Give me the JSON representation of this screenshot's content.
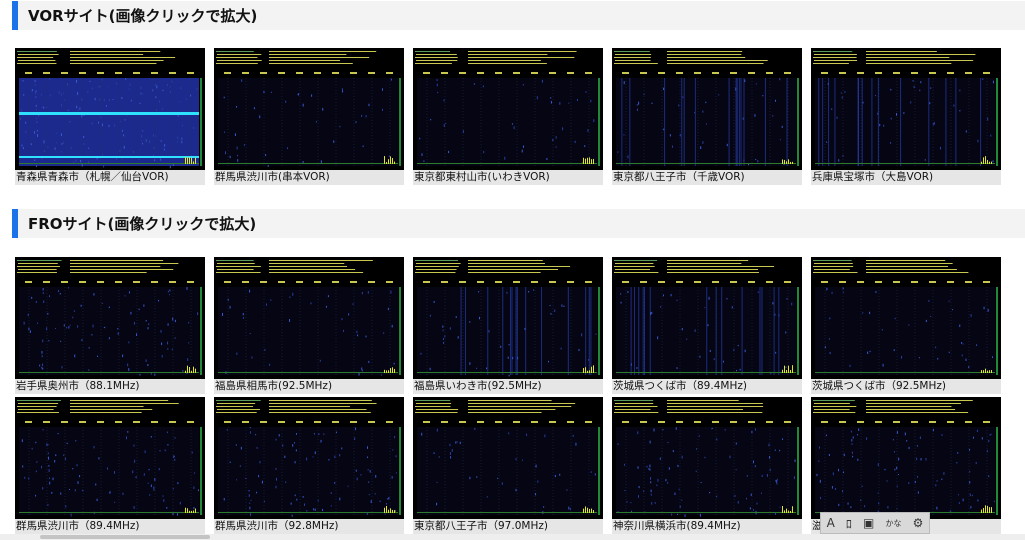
{
  "sections": [
    {
      "title": "VORサイト(画像クリックで拡大)",
      "cards": [
        {
          "caption": "青森県青森市（札幌／仙台VOR)",
          "variant": "dense-blue",
          "header_text": "HROFFT"
        },
        {
          "caption": "群馬県渋川市(串本VOR)",
          "variant": "sparse",
          "header_text": "HROFFT"
        },
        {
          "caption": "東京都東村山市(いわきVOR)",
          "variant": "sparse",
          "header_text": "HROFFT"
        },
        {
          "caption": "東京都八王子市（千歳VOR)",
          "variant": "streaks",
          "header_text": "HROFFT"
        },
        {
          "caption": "兵庫県宝塚市（大島VOR)",
          "variant": "streaks",
          "header_text": "HROFFT"
        }
      ]
    },
    {
      "title": "FROサイト(画像クリックで拡大)",
      "cards": [
        {
          "caption": "岩手県奥州市（88.1MHz)",
          "variant": "noise",
          "header_text": "HROFFT"
        },
        {
          "caption": "福島県相馬市(92.5MHz)",
          "variant": "sparse",
          "header_text": "HROFFT"
        },
        {
          "caption": "福島県いわき市(92.5MHz)",
          "variant": "streaks",
          "header_text": "HROFFT"
        },
        {
          "caption": "茨城県つくば市（89.4MHz)",
          "variant": "streaks",
          "header_text": "HROFFT"
        },
        {
          "caption": "茨城県つくば市（92.5MHz)",
          "variant": "sparse",
          "header_text": "HROFFT"
        },
        {
          "caption": "群馬県渋川市（89.4MHz)",
          "variant": "noise",
          "header_text": "HROFFT"
        },
        {
          "caption": "群馬県渋川市（92.8MHz)",
          "variant": "noise",
          "header_text": "HROFFT"
        },
        {
          "caption": "東京都八王子市（97.0MHz)",
          "variant": "sparse",
          "header_text": "HROFFT"
        },
        {
          "caption": "神奈川県横浜市(89.4MHz)",
          "variant": "noise",
          "header_text": "HROFFT"
        },
        {
          "caption": "滋",
          "variant": "noise",
          "header_text": "HROFFT"
        }
      ]
    }
  ],
  "toolbar": {
    "items": [
      {
        "label": "A",
        "icon": "text-size-icon"
      },
      {
        "label": "ﾛ",
        "icon": "speaker-icon"
      },
      {
        "label": "▣",
        "icon": "reader-icon"
      },
      {
        "label": "かな",
        "icon": "furigana-icon"
      },
      {
        "label": "⚙",
        "icon": "settings-icon"
      }
    ]
  },
  "colors": {
    "accent": "#1a73e8",
    "spectrogram_bg": "#000010",
    "spectrogram_blue": "#1a2a8a",
    "caption_bg": "#e6e6e6"
  }
}
